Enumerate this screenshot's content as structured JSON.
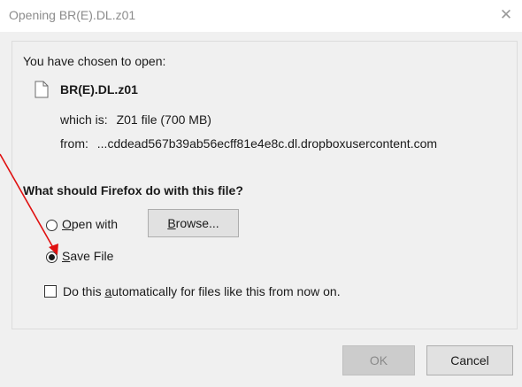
{
  "window": {
    "title": "Opening BR(E).DL.z01",
    "close_glyph": "✕"
  },
  "file": {
    "chosen_label": "You have chosen to open:",
    "name": "BR(E).DL.z01",
    "which_label": "which is:",
    "which_value": "Z01 file (700 MB)",
    "from_label": "from:",
    "from_value": "...cddead567b39ab56ecff81e4e8c.dl.dropboxusercontent.com"
  },
  "action": {
    "question": "What should Firefox do with this file?",
    "open_with": {
      "accel": "O",
      "rest": "pen with",
      "selected": false
    },
    "browse": {
      "accel": "B",
      "rest": "rowse..."
    },
    "save_file": {
      "accel": "S",
      "rest": "ave File",
      "selected": true
    },
    "auto": {
      "pre": "Do this ",
      "accel": "a",
      "post": "utomatically for files like this from now on.",
      "checked": false
    }
  },
  "buttons": {
    "ok": "OK",
    "cancel": "Cancel"
  },
  "colors": {
    "annotation_arrow": "#e01010",
    "dialog_bg": "#f0f0f0",
    "disabled_text": "#8a8a8a"
  },
  "icons": {
    "file": "file-icon",
    "close": "close-icon"
  }
}
